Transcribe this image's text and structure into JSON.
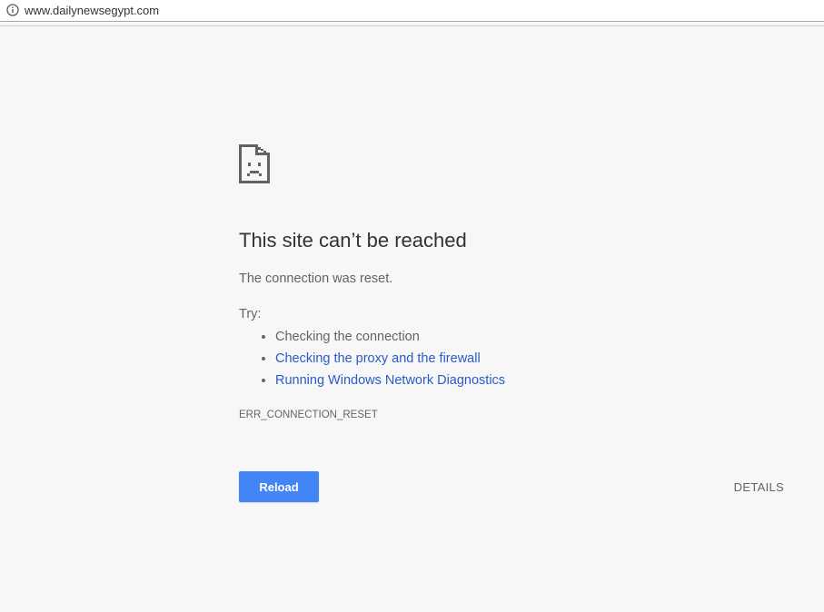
{
  "address_bar": {
    "url": "www.dailynewsegypt.com",
    "info_icon": "info-circle-icon"
  },
  "error_page": {
    "icon": "sad-page-icon",
    "title": "This site can’t be reached",
    "subtitle": "The connection was reset.",
    "try_label": "Try:",
    "suggestions": [
      {
        "label": "Checking the connection",
        "is_link": false
      },
      {
        "label": "Checking the proxy and the firewall",
        "is_link": true
      },
      {
        "label": "Running Windows Network Diagnostics",
        "is_link": true
      }
    ],
    "error_code": "ERR_CONNECTION_RESET",
    "reload_label": "Reload",
    "details_label": "DETAILS"
  },
  "colors": {
    "background": "#f7f7f7",
    "link": "#2a5bc9",
    "primary_button": "#4285f4",
    "text": "#646464",
    "title_text": "#333333"
  }
}
